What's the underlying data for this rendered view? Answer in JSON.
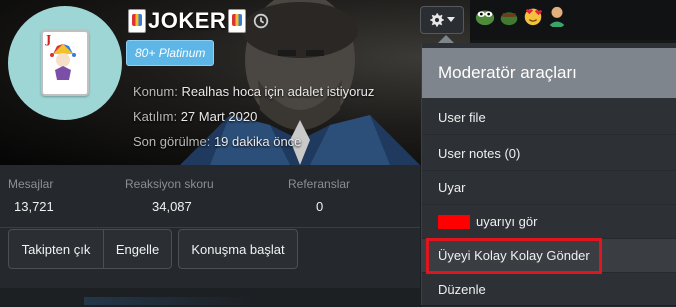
{
  "profile": {
    "username": "JOKER",
    "rank_badge": "80+ Platinum",
    "info": {
      "location_label": "Konum:",
      "location_value": "Realhas hoca için adalet istiyoruz",
      "joined_label": "Katılım:",
      "joined_value": "27 Mart 2020",
      "last_seen_label": "Son görülme:",
      "last_seen_value": "19 dakika önce"
    }
  },
  "stats": {
    "messages_label": "Mesajlar",
    "messages_value": "13,721",
    "reaction_label": "Reaksiyon skoru",
    "reaction_value": "34,087",
    "references_label": "Referanslar",
    "references_value": "0"
  },
  "actions": {
    "unfollow": "Takipten çık",
    "block": "Engelle",
    "start_conversation": "Konuşma başlat"
  },
  "moderator_menu": {
    "title": "Moderatör araçları",
    "items": [
      "User file",
      "User notes (0)",
      "Uyar",
      "uyarıyı gör",
      "Üyeyi Kolay Kolay Gönder",
      "Düzenle"
    ]
  },
  "colors": {
    "badge": "#5db6e6",
    "menu_header": "#7f858c",
    "highlight": "#e0151d",
    "redacted": "#ff0000"
  },
  "icons": {
    "settings": "gear-icon",
    "history": "history-icon",
    "dropdown": "caret-down-icon"
  }
}
